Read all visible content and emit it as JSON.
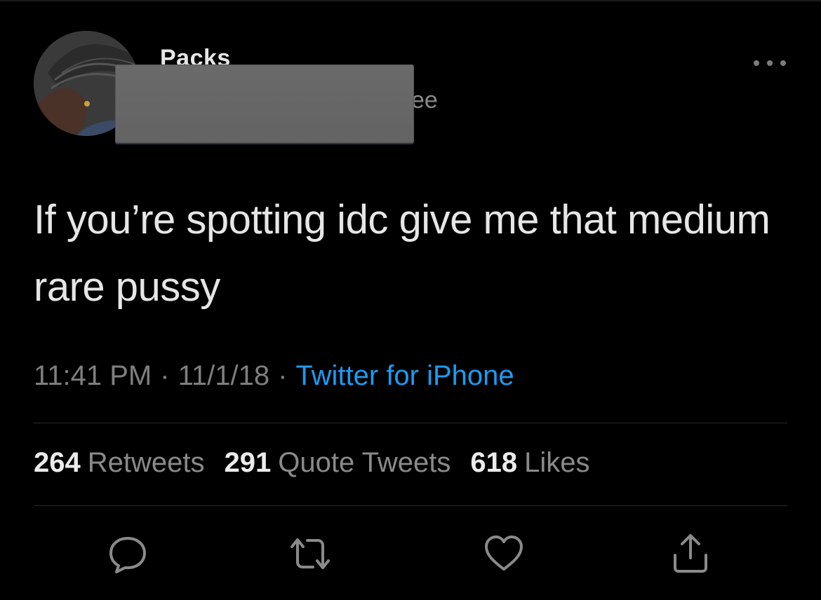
{
  "author": {
    "display_name": "Packs",
    "handle_visible_fragment": "ee"
  },
  "tweet": {
    "text": "If you’re spotting idc give me that medium rare pussy",
    "time": "11:41 PM",
    "separator": "·",
    "date": "11/1/18",
    "source": "Twitter for iPhone"
  },
  "stats": [
    {
      "count": "264",
      "label": "Retweets"
    },
    {
      "count": "291",
      "label": "Quote Tweets"
    },
    {
      "count": "618",
      "label": "Likes"
    }
  ],
  "icons": {
    "more": "more-horizontal-icon",
    "reply": "reply-icon",
    "retweet": "retweet-icon",
    "like": "heart-icon",
    "share": "share-icon"
  },
  "colors": {
    "background": "#000000",
    "link": "#1d9bf0",
    "muted": "#7f7f7f",
    "text": "#e6e6e6",
    "redaction": "#666666"
  }
}
